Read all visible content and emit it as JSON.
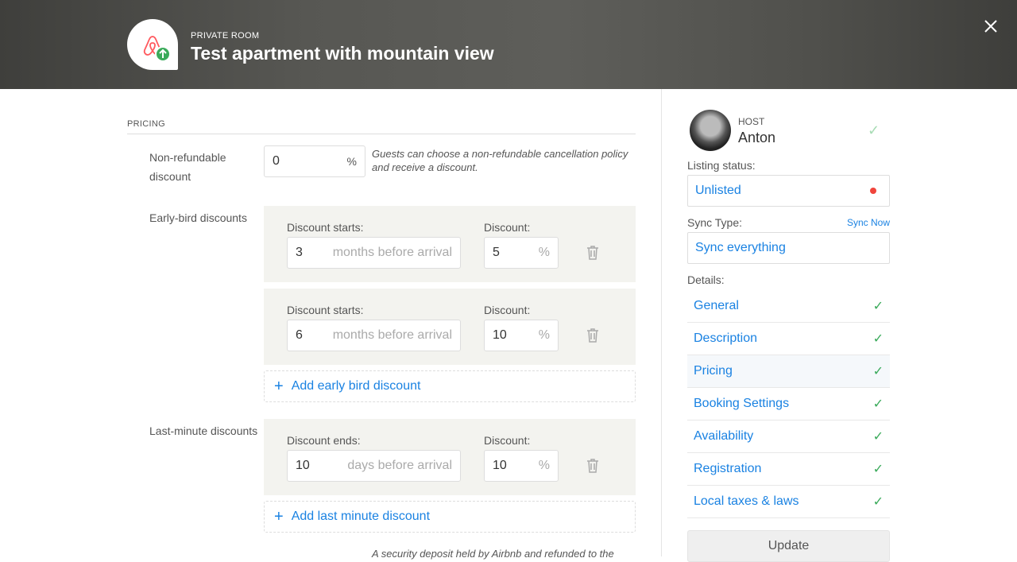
{
  "header": {
    "kicker": "PRIVATE ROOM",
    "title": "Test apartment with mountain view",
    "logo": "airbnb-logo",
    "badge_icon": "arrow-up-icon",
    "close_icon": "close-icon"
  },
  "pricing": {
    "section": "PRICING",
    "non_refundable": {
      "label": "Non-refundable discount",
      "value": "0",
      "suffix": "%",
      "help": "Guests can choose a non-refundable cancellation policy and receive a discount."
    },
    "early_bird": {
      "label": "Early-bird discounts",
      "items": [
        {
          "starts_label": "Discount starts:",
          "starts": "3",
          "unit": "months before arrival",
          "discount_label": "Discount:",
          "discount": "5",
          "suffix": "%"
        },
        {
          "starts_label": "Discount starts:",
          "starts": "6",
          "unit": "months before arrival",
          "discount_label": "Discount:",
          "discount": "10",
          "suffix": "%"
        }
      ],
      "add": "Add early bird discount"
    },
    "last_minute": {
      "label": "Last-minute discounts",
      "items": [
        {
          "starts_label": "Discount ends:",
          "starts": "10",
          "unit": "days before arrival",
          "discount_label": "Discount:",
          "discount": "10",
          "suffix": "%"
        }
      ],
      "add": "Add last minute discount"
    },
    "footnote": "A security deposit held by Airbnb and refunded to the"
  },
  "sidebar": {
    "host_label": "HOST",
    "host_name": "Anton",
    "listing_status_label": "Listing status:",
    "listing_status": "Unlisted",
    "status_color": "#f0453c",
    "sync_type_label": "Sync Type:",
    "sync_now": "Sync Now",
    "sync_type": "Sync everything",
    "details_label": "Details:",
    "details": [
      {
        "label": "General"
      },
      {
        "label": "Description"
      },
      {
        "label": "Pricing",
        "active": true
      },
      {
        "label": "Booking Settings"
      },
      {
        "label": "Availability"
      },
      {
        "label": "Registration"
      },
      {
        "label": "Local taxes & laws"
      }
    ],
    "update": "Update"
  },
  "colors": {
    "accent": "#1a82e2",
    "check": "#3aaa5a"
  }
}
